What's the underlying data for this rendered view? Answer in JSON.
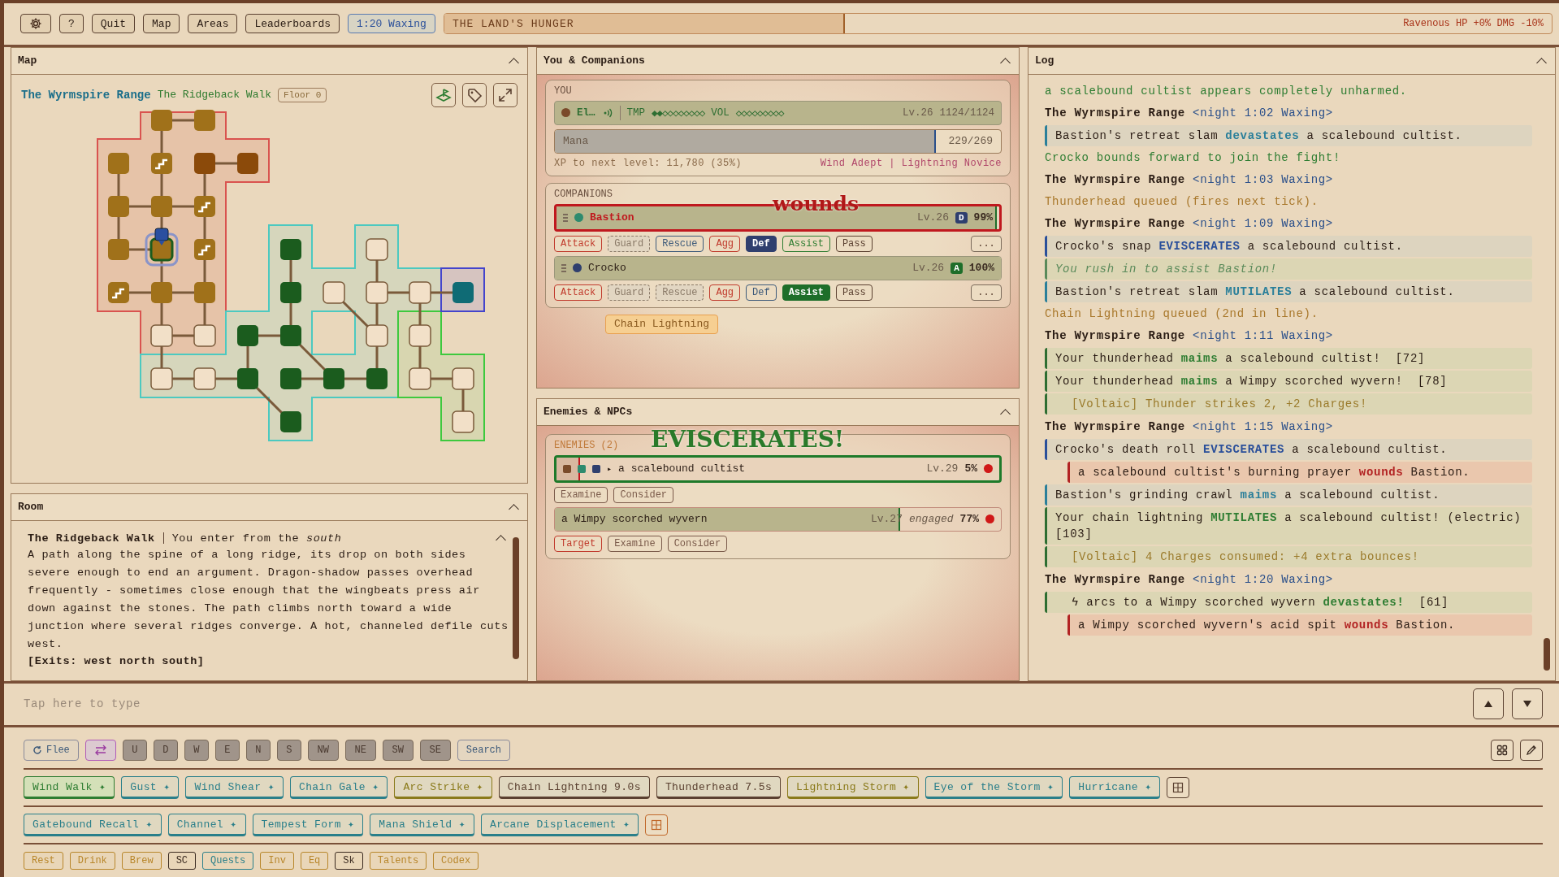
{
  "toolbar": {
    "buttons": [
      "?",
      "Quit",
      "Map",
      "Areas",
      "Leaderboards"
    ],
    "time": "1:20 Waxing",
    "event": {
      "title": "THE LAND'S HUNGER",
      "level": 0.36,
      "status": "Ravenous HP +0% DMG -10%"
    }
  },
  "map_panel": {
    "title": "Map",
    "area": "The Wyrmspire Range",
    "room": "The Ridgeback Walk",
    "floor": "Floor 0"
  },
  "room_panel": {
    "title": "Room",
    "name": "The Ridgeback Walk",
    "entry": "You enter from the *south*",
    "description": "A path along the spine of a long ridge, its drop on both sides severe enough to end an argument. Dragon-shadow passes overhead frequently - sometimes close enough that the wingbeats press air down against the stones. The path climbs north toward a wide junction where several ridges converge. A hot, channeled defile cuts west.",
    "exits": "[Exits: west north south]"
  },
  "party_panel": {
    "title": "You & Companions",
    "you_label": "YOU",
    "player": {
      "name": "El…",
      "color": "#7a4a2a",
      "tmp_label": "TMP",
      "tmp": "◆◆◇◇◇◇◇◇◇◇",
      "vol_label": "VOL",
      "vol": "◇◇◇◇◇◇◇◇◇",
      "lv": "Lv.26",
      "hp": "1124/1124"
    },
    "mana": {
      "label": "Mana",
      "level": 0.851,
      "reading": "229/269"
    },
    "xp": "XP to next level: 11,780 (35%)",
    "titles": "Wind Adept | Lightning Novice",
    "companions_label": "COMPANIONS",
    "companions": [
      {
        "name": "Bastion",
        "color": "#2e8b6e",
        "alert": true,
        "lv": "Lv.26",
        "stance": {
          "label": "D",
          "color": "#2f3f6e"
        },
        "hp": "99%",
        "level": 0.99,
        "more": "...",
        "actions": [
          {
            "label": "Attack",
            "color": "#c0392b",
            "selected": false,
            "disabled": false
          },
          {
            "label": "Guard",
            "color": "#8a7a68",
            "selected": false,
            "disabled": true
          },
          {
            "label": "Rescue",
            "color": "#3d5a7a",
            "selected": false,
            "disabled": false
          },
          {
            "label": "Agg",
            "color": "#c0392b",
            "selected": false,
            "disabled": false
          },
          {
            "label": "Def",
            "color": "#2f3f6e",
            "selected": true,
            "disabled": false
          },
          {
            "label": "Assist",
            "color": "#2e7d32",
            "selected": false,
            "disabled": false
          },
          {
            "label": "Pass",
            "color": "#5a4030",
            "selected": false,
            "disabled": false
          }
        ]
      },
      {
        "name": "Crocko",
        "color": "#2f3f6e",
        "alert": false,
        "lv": "Lv.26",
        "stance": {
          "label": "A",
          "color": "#1e6e2a"
        },
        "hp": "100%",
        "level": 1,
        "more": "...",
        "actions": [
          {
            "label": "Attack",
            "color": "#c0392b",
            "selected": false,
            "disabled": false
          },
          {
            "label": "Guard",
            "color": "#8a7a68",
            "selected": false,
            "disabled": true
          },
          {
            "label": "Rescue",
            "color": "#8a7a68",
            "selected": false,
            "disabled": true
          },
          {
            "label": "Agg",
            "color": "#c0392b",
            "selected": false,
            "disabled": false
          },
          {
            "label": "Def",
            "color": "#3d5a7a",
            "selected": false,
            "disabled": false
          },
          {
            "label": "Assist",
            "color": "#1e6e2a",
            "selected": true,
            "disabled": false
          },
          {
            "label": "Pass",
            "color": "#5a4030",
            "selected": false,
            "disabled": false
          }
        ]
      }
    ],
    "queued": {
      "label": "Chain Lightning",
      "disabled": true
    },
    "float_text": {
      "text": "wounds",
      "color": "#b01818"
    }
  },
  "enemies_panel": {
    "title": "Enemies & NPCs",
    "label": "ENEMIES (2)",
    "float_text": {
      "text": "EVISCERATES!",
      "color": "#2a7a2a"
    },
    "enemies": [
      {
        "markers": [
          {
            "color": "#7a4a2a"
          },
          {
            "color": "#2e8b6e"
          },
          {
            "color": "#2f3f6e"
          }
        ],
        "toggle": "▸",
        "name": "a scalebound cultist",
        "lv": "Lv.29",
        "hp": "5%",
        "level": 0.05,
        "selected": true,
        "actions": [
          {
            "label": "Examine",
            "color": "#7a5a4a"
          },
          {
            "label": "Consider",
            "color": "#7a5a4a"
          }
        ]
      },
      {
        "name": "a Wimpy scorched wyvern",
        "lv": "Lv.27",
        "status": "engaged",
        "hp": "77%",
        "level": 0.77,
        "selected": false,
        "actions": [
          {
            "label": "Target",
            "color": "#c0392b"
          },
          {
            "label": "Examine",
            "color": "#7a5a4a"
          },
          {
            "label": "Consider",
            "color": "#7a5a4a"
          }
        ]
      }
    ]
  },
  "log": {
    "title": "Log",
    "entries": [
      {
        "kind": "plain",
        "color": "#2e7d32",
        "parts": [
          {
            "text": "a scalebound cultist appears completely unharmed."
          }
        ]
      },
      {
        "kind": "header",
        "parts": [
          {
            "text": "The Wyrmspire Range "
          },
          {
            "text": "<night 1:02 Waxing>",
            "color": "#2a4f8a"
          }
        ]
      },
      {
        "kind": "ally",
        "color": "#2a7f9a",
        "parts": [
          {
            "text": "Bastion's retreat slam "
          },
          {
            "text": "devastates",
            "color": "#2a7f9a"
          },
          {
            "text": " a scalebound cultist."
          }
        ]
      },
      {
        "kind": "plain",
        "color": "#2e7d32",
        "parts": [
          {
            "text": "Crocko bounds forward to join the fight!"
          }
        ]
      },
      {
        "kind": "header",
        "parts": [
          {
            "text": "The Wyrmspire Range "
          },
          {
            "text": "<night 1:03 Waxing>",
            "color": "#2a4f8a"
          }
        ]
      },
      {
        "kind": "plain",
        "color": "#a8772a",
        "parts": [
          {
            "text": "Thunderhead queued (fires next tick)."
          }
        ]
      },
      {
        "kind": "header",
        "parts": [
          {
            "text": "The Wyrmspire Range "
          },
          {
            "text": "<night 1:09 Waxing>",
            "color": "#2a4f8a"
          }
        ]
      },
      {
        "kind": "ally",
        "color": "#2a4f9a",
        "parts": [
          {
            "text": "Crocko's snap "
          },
          {
            "text": "EVISCERATES",
            "color": "#2a4f9a"
          },
          {
            "text": " a scalebound cultist."
          }
        ]
      },
      {
        "kind": "note",
        "color": "#5a8a5a",
        "parts": [
          {
            "text": "You rush in to assist Bastion!"
          }
        ]
      },
      {
        "kind": "ally",
        "color": "#2a7f9a",
        "parts": [
          {
            "text": "Bastion's retreat slam "
          },
          {
            "text": "MUTILATES",
            "color": "#2a7f9a"
          },
          {
            "text": " a scalebound cultist."
          }
        ]
      },
      {
        "kind": "plain",
        "color": "#a8772a",
        "parts": [
          {
            "text": "Chain Lightning queued (2nd in line)."
          }
        ]
      },
      {
        "kind": "header",
        "parts": [
          {
            "text": "The Wyrmspire Range "
          },
          {
            "text": "<night 1:11 Waxing>",
            "color": "#2a4f8a"
          }
        ]
      },
      {
        "kind": "you",
        "color": "#2e6e32",
        "parts": [
          {
            "text": "Your thunderhead "
          },
          {
            "text": "maims",
            "color": "#2e7d32"
          },
          {
            "text": " a scalebound cultist!  [72]"
          }
        ]
      },
      {
        "kind": "you",
        "color": "#2e6e32",
        "parts": [
          {
            "text": "Your thunderhead "
          },
          {
            "text": "maims",
            "color": "#2e7d32"
          },
          {
            "text": " a Wimpy scorched wyvern!  [78]"
          }
        ]
      },
      {
        "kind": "sub",
        "color": "#2e6e32",
        "parts": [
          {
            "text": "[Voltaic] Thunder strikes 2, +2 Charges!"
          }
        ]
      },
      {
        "kind": "header",
        "parts": [
          {
            "text": "The Wyrmspire Range "
          },
          {
            "text": "<night 1:15 Waxing>",
            "color": "#2a4f8a"
          }
        ]
      },
      {
        "kind": "ally",
        "color": "#2a4f9a",
        "parts": [
          {
            "text": "Crocko's death roll "
          },
          {
            "text": "EVISCERATES",
            "color": "#2a4f9a"
          },
          {
            "text": " a scalebound cultist."
          }
        ]
      },
      {
        "kind": "enemy",
        "color": "#b22222",
        "parts": [
          {
            "text": "a scalebound cultist's burning prayer "
          },
          {
            "text": "wounds",
            "color": "#b22222"
          },
          {
            "text": " Bastion."
          }
        ]
      },
      {
        "kind": "ally",
        "color": "#2a7f9a",
        "parts": [
          {
            "text": "Bastion's grinding crawl "
          },
          {
            "text": "maims",
            "color": "#2a7f9a"
          },
          {
            "text": " a scalebound cultist."
          }
        ]
      },
      {
        "kind": "you",
        "color": "#2e6e32",
        "parts": [
          {
            "text": "Your chain lightning "
          },
          {
            "text": "MUTILATES",
            "color": "#2e7d32"
          },
          {
            "text": " a scalebound cultist! (electric)  [103]"
          }
        ]
      },
      {
        "kind": "sub",
        "color": "#2e6e32",
        "parts": [
          {
            "text": "[Voltaic] 4 Charges consumed: +4 extra bounces!"
          }
        ]
      },
      {
        "kind": "header",
        "parts": [
          {
            "text": "The Wyrmspire Range "
          },
          {
            "text": "<night 1:20 Waxing>",
            "color": "#2a4f8a"
          }
        ]
      },
      {
        "kind": "arc",
        "color": "#2e6e32",
        "parts": [
          {
            "text": "ϟ arcs to a Wimpy scorched wyvern "
          },
          {
            "text": "devastates!",
            "color": "#2e7d32"
          },
          {
            "text": "  [61]"
          }
        ]
      },
      {
        "kind": "enemy",
        "color": "#b22222",
        "parts": [
          {
            "text": "a Wimpy scorched wyvern's acid spit "
          },
          {
            "text": "wounds",
            "color": "#b22222"
          },
          {
            "text": " Bastion."
          }
        ]
      }
    ]
  },
  "input": {
    "placeholder": "Tap here to type"
  },
  "controls": {
    "flee": "Flee",
    "directions": [
      "U",
      "D",
      "W",
      "E",
      "N",
      "S",
      "NW",
      "NE",
      "SW",
      "SE"
    ],
    "search": "Search"
  },
  "skill_rows": [
    [
      {
        "label": "Wind Walk ✦",
        "color": "#2e7d32",
        "active": true
      },
      {
        "label": "Gust ✦",
        "color": "#2a7f8a",
        "active": false
      },
      {
        "label": "Wind Shear ✦",
        "color": "#2a7f8a",
        "active": false
      },
      {
        "label": "Chain Gale ✦",
        "color": "#2a7f8a",
        "active": false
      },
      {
        "label": "Arc Strike ✦",
        "color": "#8a7a1a",
        "active": false
      },
      {
        "label": "Chain Lightning 9.0s",
        "color": "#5a4030",
        "active": false
      },
      {
        "label": "Thunderhead 7.5s",
        "color": "#5a4030",
        "active": false
      },
      {
        "label": "Lightning Storm ✦",
        "color": "#8a7a1a",
        "active": false
      },
      {
        "label": "Eye of the Storm ✦",
        "color": "#2a7f8a",
        "active": false
      },
      {
        "label": "Hurricane ✦",
        "color": "#2a7f8a",
        "active": false
      }
    ],
    [
      {
        "label": "Gatebound Recall ✦",
        "color": "#2a7f8a",
        "active": false
      },
      {
        "label": "Channel ✦",
        "color": "#2a7f8a",
        "active": false
      },
      {
        "label": "Tempest Form ✦",
        "color": "#2a7f8a",
        "active": false
      },
      {
        "label": "Mana Shield ✦",
        "color": "#2a7f8a",
        "active": false
      },
      {
        "label": "Arcane Displacement ✦",
        "color": "#2a7f8a",
        "active": false
      }
    ]
  ],
  "utility": [
    {
      "label": "Rest",
      "color": "#b8862a"
    },
    {
      "label": "Drink",
      "color": "#b8862a"
    },
    {
      "label": "Brew",
      "color": "#b8862a"
    },
    {
      "label": "SC",
      "color": "#3a2a20"
    },
    {
      "label": "Quests",
      "color": "#2a7f8a"
    },
    {
      "label": "Inv",
      "color": "#b8862a"
    },
    {
      "label": "Eq",
      "color": "#b8862a"
    },
    {
      "label": "Sk",
      "color": "#3a2a20"
    },
    {
      "label": "Talents",
      "color": "#b8862a"
    },
    {
      "label": "Codex",
      "color": "#b8862a"
    }
  ]
}
